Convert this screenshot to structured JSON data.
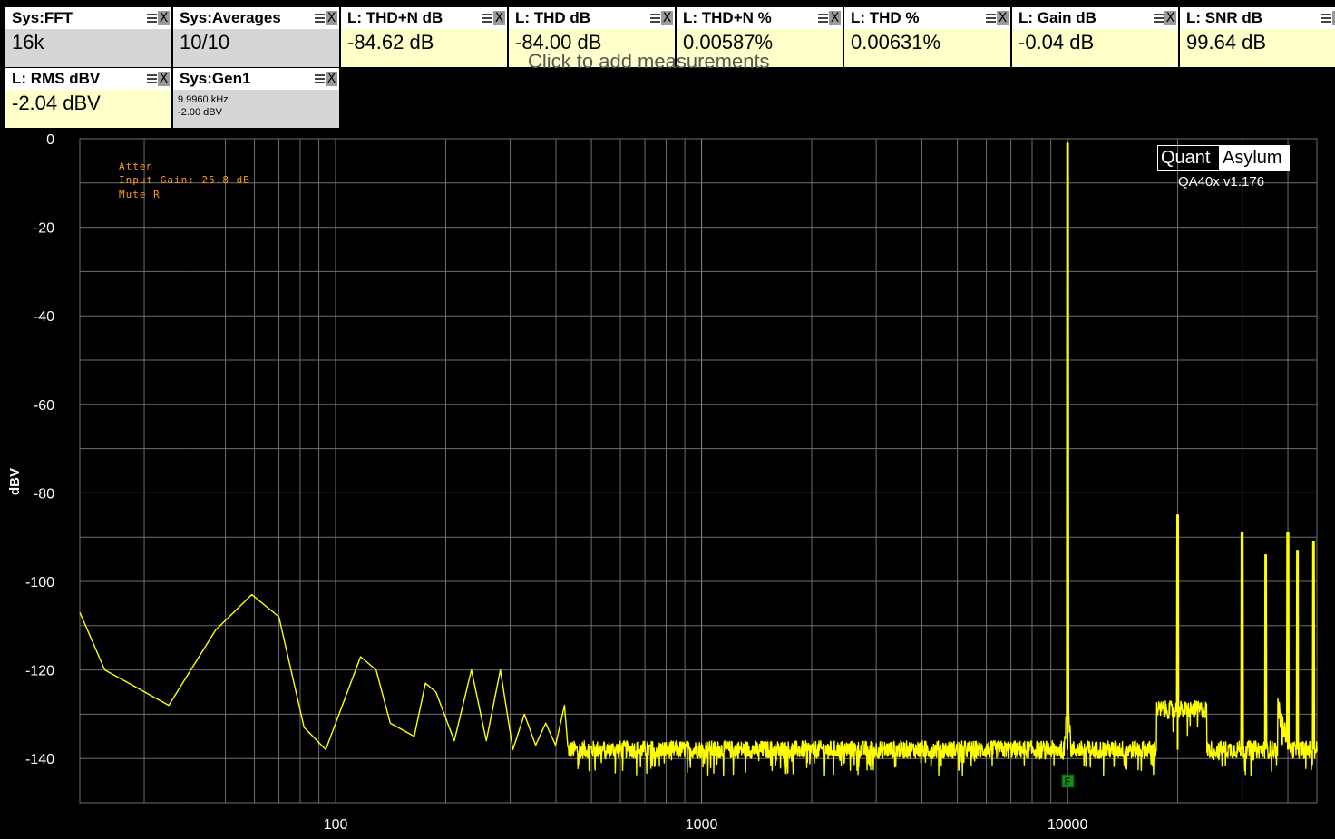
{
  "tiles": [
    {
      "title": "Sys:FFT",
      "value": "16k",
      "kind": "sys"
    },
    {
      "title": "Sys:Averages",
      "value": "10/10",
      "kind": "sys"
    },
    {
      "title": "L: THD+N dB",
      "value": "-84.62 dB",
      "kind": "meas"
    },
    {
      "title": "L: THD dB",
      "value": "-84.00 dB",
      "kind": "meas"
    },
    {
      "title": "L: THD+N %",
      "value": "0.00587%",
      "kind": "meas"
    },
    {
      "title": "L: THD %",
      "value": "0.00631%",
      "kind": "meas"
    },
    {
      "title": "L: Gain dB",
      "value": "-0.04 dB",
      "kind": "meas"
    },
    {
      "title": "L: SNR dB",
      "value": "99.64 dB",
      "kind": "meas"
    },
    {
      "title": "L: RMS dBV",
      "value": "-2.04 dBV",
      "kind": "meas"
    },
    {
      "title": "Sys:Gen1",
      "value_lines": [
        "9.9960 kHz",
        "-2.00 dBV"
      ],
      "kind": "sys"
    }
  ],
  "tile_close_glyph": "X",
  "ghost_text": "Click to add measurements",
  "logo": {
    "left": "Quant",
    "right": "Asylum"
  },
  "version": "QA40x v1.176",
  "notes": [
    "Atten",
    "Input Gain: 25.8 dB",
    "Mute R"
  ],
  "marker_label": "F",
  "colors": {
    "trace": "#ffff00",
    "grid": "#6e6e6e",
    "notes": "#ff9a1a",
    "marker": "#1a8a1a"
  },
  "chart_data": {
    "type": "line",
    "ylabel": "dBV",
    "xlabel": "",
    "x_scale": "log",
    "xlim": [
      20,
      48000
    ],
    "ylim": [
      -150,
      0
    ],
    "x_ticks": [
      100,
      1000,
      10000
    ],
    "y_ticks": [
      0,
      -20,
      -40,
      -60,
      -80,
      -100,
      -120,
      -140
    ],
    "grid": true,
    "series": [
      {
        "color": "#ffff00",
        "noise_floor_dBV": -138,
        "x": [
          20,
          23.4,
          35,
          47,
          59,
          70,
          82,
          94,
          117,
          129,
          141,
          164,
          176,
          188,
          211,
          235,
          258,
          282,
          305,
          328,
          352,
          375,
          399,
          422
        ],
        "y": [
          -107,
          -120,
          -128,
          -111,
          -103,
          -108,
          -133,
          -138,
          -117,
          -120,
          -132,
          -135,
          -123,
          -125,
          -136,
          -120,
          -136,
          -120,
          -138,
          -130,
          -137,
          -132,
          -137,
          -128
        ],
        "peaks": [
          {
            "x": 9996,
            "y": -1
          },
          {
            "x": 19992,
            "y": -85
          },
          {
            "x": 29988,
            "y": -89
          },
          {
            "x": 34800,
            "y": -94
          },
          {
            "x": 39984,
            "y": -89
          },
          {
            "x": 42500,
            "y": -93
          },
          {
            "x": 47000,
            "y": -91
          }
        ]
      }
    ],
    "marker": {
      "x": 9996,
      "label": "F"
    }
  }
}
